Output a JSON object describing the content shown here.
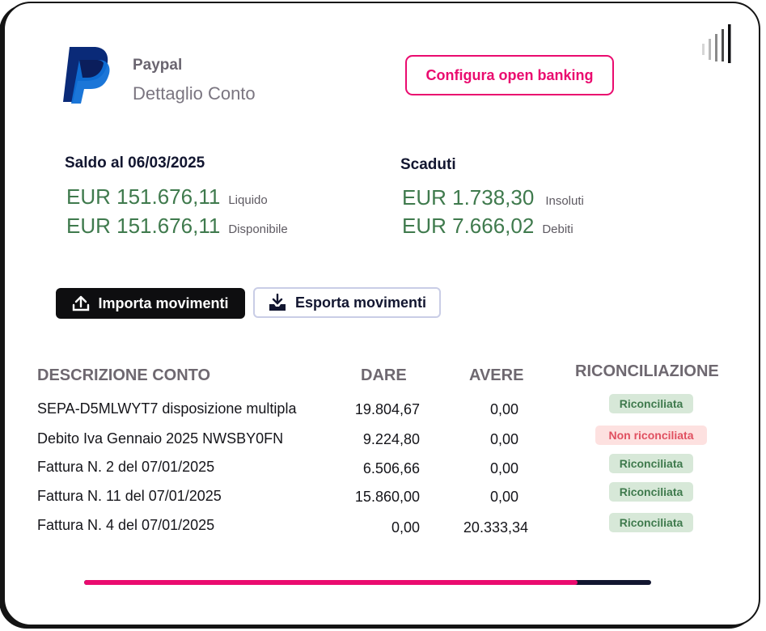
{
  "account": {
    "name": "Paypal",
    "subtitle": "Dettaglio Conto",
    "open_banking_label": "Configura open banking"
  },
  "balance": {
    "title": "Saldo al 06/03/2025",
    "liquid_amount": "EUR 151.676,11",
    "liquid_label": "Liquido",
    "available_amount": "EUR 151.676,11",
    "available_label": "Disponibile"
  },
  "overdue": {
    "title": "Scaduti",
    "unpaid_amount": "EUR 1.738,30",
    "unpaid_label": "Insoluti",
    "debts_amount": "EUR 7.666,02",
    "debts_label": "Debiti"
  },
  "actions": {
    "import_label": "Importa movimenti",
    "export_label": "Esporta movimenti"
  },
  "table": {
    "headers": {
      "description": "DESCRIZIONE CONTO",
      "debit": "DARE",
      "credit": "AVERE",
      "reconciliation": "RICONCILIAZIONE"
    },
    "rows": [
      {
        "description": "SEPA-D5MLWYT7 disposizione multipla",
        "debit": "19.804,67",
        "credit": "0,00",
        "status": "Riconciliata"
      },
      {
        "description": "Debito Iva Gennaio 2025 NWSBY0FN",
        "debit": "9.224,80",
        "credit": "0,00",
        "status": "Non riconciliata"
      },
      {
        "description": "Fattura N. 2 del 07/01/2025",
        "debit": "6.506,66",
        "credit": "0,00",
        "status": "Riconciliata"
      },
      {
        "description": "Fattura N. 11 del 07/01/2025",
        "debit": "15.860,00",
        "credit": "0,00",
        "status": "Riconciliata"
      },
      {
        "description": "Fattura N. 4 del 07/01/2025",
        "debit": "0,00",
        "credit": "20.333,34",
        "status": "Riconciliata"
      }
    ]
  },
  "progress": {
    "value_percent": 87
  },
  "colors": {
    "brand_pink": "#ea0b6f",
    "amount_green": "#3f7a4d",
    "reconciled_bg": "#d7e8d8",
    "not_reconciled_bg": "#fde1e0",
    "not_reconciled_text": "#e05060"
  },
  "icons": {
    "logo": "paypal-logo",
    "signal": "signal-bars-icon",
    "import": "upload-icon",
    "export": "download-icon"
  }
}
